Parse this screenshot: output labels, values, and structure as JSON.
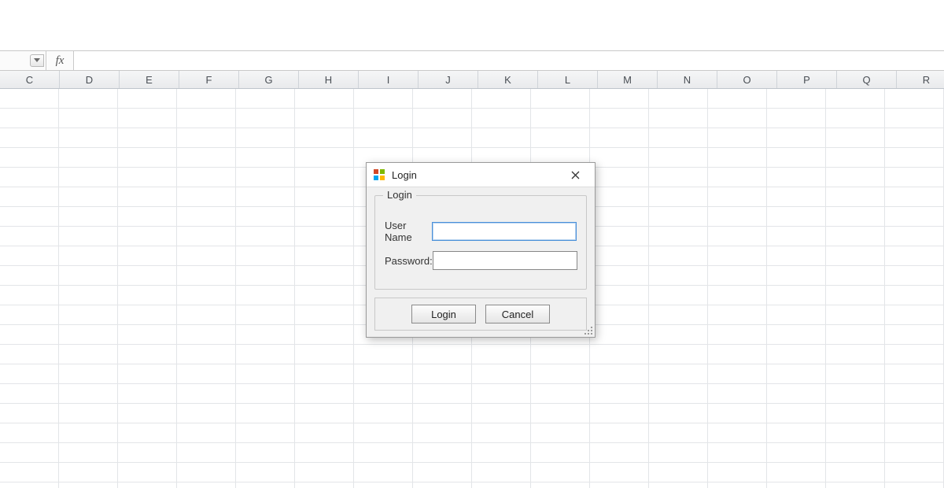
{
  "formula_bar": {
    "fx_label": "fx",
    "formula_value": ""
  },
  "columns": [
    "C",
    "D",
    "E",
    "F",
    "G",
    "H",
    "I",
    "J",
    "K",
    "L",
    "M",
    "N",
    "O",
    "P",
    "Q",
    "R"
  ],
  "dialog": {
    "title": "Login",
    "group_legend": "Login",
    "username_label": "User Name",
    "username_value": "",
    "password_label": "Password:",
    "password_value": "",
    "login_button": "Login",
    "cancel_button": "Cancel"
  }
}
